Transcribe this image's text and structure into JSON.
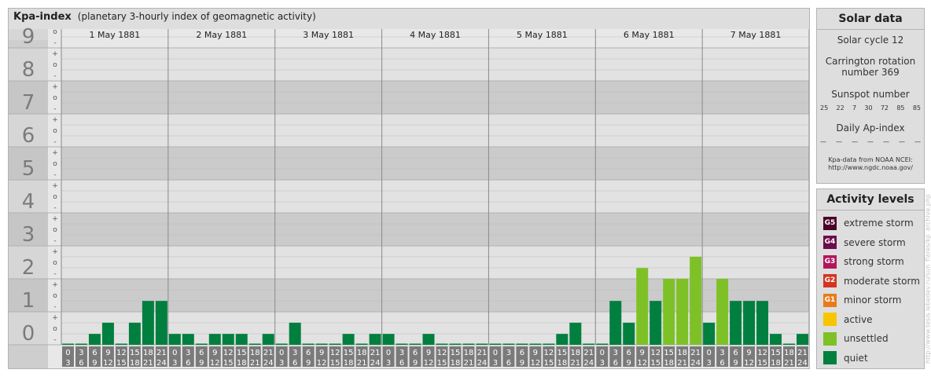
{
  "chart_data": {
    "type": "bar",
    "title": "Kpa-index",
    "subtitle": "(planetary 3-hourly index of geomagnetic activity)",
    "ylim": [
      0,
      9
    ],
    "y_ticks": [
      "0",
      "1",
      "2",
      "3",
      "4",
      "5",
      "6",
      "7",
      "8",
      "9"
    ],
    "y_minor_ticks": [
      "+",
      "o",
      "-"
    ],
    "x_days": [
      "1 May 1881",
      "2 May 1881",
      "3 May 1881",
      "4 May 1881",
      "5 May 1881",
      "6 May 1881",
      "7 May 1881"
    ],
    "x_intervals": [
      [
        "0",
        "3"
      ],
      [
        "3",
        "6"
      ],
      [
        "6",
        "9"
      ],
      [
        "9",
        "12"
      ],
      [
        "12",
        "15"
      ],
      [
        "15",
        "18"
      ],
      [
        "18",
        "21"
      ],
      [
        "21",
        "24"
      ]
    ],
    "values": [
      [
        0,
        0,
        0.33,
        0.67,
        0,
        0.67,
        1.33,
        1.33
      ],
      [
        0.33,
        0.33,
        0,
        0.33,
        0.33,
        0.33,
        0,
        0.33
      ],
      [
        0,
        0.67,
        0,
        0,
        0,
        0.33,
        0,
        0.33
      ],
      [
        0.33,
        0,
        0,
        0.33,
        0,
        0,
        0,
        0
      ],
      [
        0,
        0,
        0,
        0,
        0,
        0.33,
        0.67,
        0
      ],
      [
        0,
        1.33,
        0.67,
        2.33,
        1.33,
        2,
        2,
        2.67
      ],
      [
        0.67,
        2,
        1.33,
        1.33,
        1.33,
        0.33,
        0,
        0.33
      ]
    ],
    "grid": true
  },
  "colors": {
    "quiet": "#007f3f",
    "unsettled": "#7ec127",
    "active": "#f7c600",
    "minor_storm": "#e67c1b",
    "moderate_storm": "#d33522",
    "strong_storm": "#b1175d",
    "severe_storm": "#6d0b4c",
    "extreme_storm": "#4a0427"
  },
  "solar": {
    "title": "Solar data",
    "cycle": "Solar cycle 12",
    "carrington_line1": "Carrington rotation",
    "carrington_line2": "number 369",
    "sunspot_label": "Sunspot number",
    "sunspot_values": [
      "25",
      "22",
      "7",
      "30",
      "72",
      "85",
      "85"
    ],
    "ap_label": "Daily Ap-index",
    "ap_values": [
      "—",
      "—",
      "—",
      "—",
      "—",
      "—",
      "—"
    ],
    "source_line1": "Kpa-data from NOAA NCEI:",
    "source_line2": "http://www.ngdc.noaa.gov/"
  },
  "levels": {
    "title": "Activity levels",
    "items": [
      {
        "code": "G5",
        "label": "extreme storm",
        "color": "#4a0427"
      },
      {
        "code": "G4",
        "label": "severe storm",
        "color": "#6d0b4c"
      },
      {
        "code": "G3",
        "label": "strong storm",
        "color": "#b1175d"
      },
      {
        "code": "G2",
        "label": "moderate storm",
        "color": "#d33522"
      },
      {
        "code": "G1",
        "label": "minor storm",
        "color": "#e67c1b"
      },
      {
        "code": "",
        "label": "active",
        "color": "#f7c600"
      },
      {
        "code": "",
        "label": "unsettled",
        "color": "#7ec127"
      },
      {
        "code": "",
        "label": "quiet",
        "color": "#007f3f"
      }
    ]
  },
  "watermark": "http://www.tesis.lebedev.ru/sun_flares/kp_archive.php"
}
